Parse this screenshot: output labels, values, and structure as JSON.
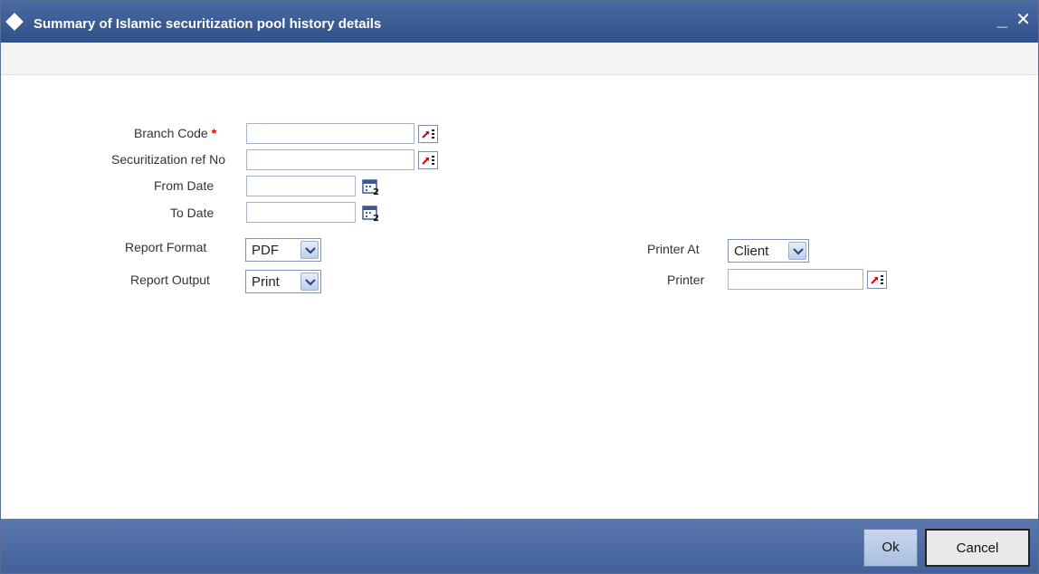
{
  "window": {
    "title": "Summary of Islamic securitization pool history details",
    "minimize_label": "_",
    "close_label": "✕"
  },
  "form": {
    "branch_code": {
      "label": "Branch Code",
      "required_mark": "*",
      "value": ""
    },
    "securitization_ref": {
      "label": "Securitization ref No",
      "value": ""
    },
    "from_date": {
      "label": "From Date",
      "value": ""
    },
    "to_date": {
      "label": "To Date",
      "value": ""
    },
    "report_format": {
      "label": "Report Format",
      "selected": "PDF"
    },
    "report_output": {
      "label": "Report Output",
      "selected": "Print"
    },
    "printer_at": {
      "label": "Printer At",
      "selected": "Client"
    },
    "printer": {
      "label": "Printer",
      "value": ""
    }
  },
  "footer": {
    "ok_label": "Ok",
    "cancel_label": "Cancel"
  },
  "colors": {
    "titlebar": "#3a5a92",
    "footer": "#4d6ba3",
    "required": "#dd0000"
  },
  "icons": {
    "lov": "list-of-values-icon",
    "calendar": "calendar-icon",
    "dropdown": "chevron-down-icon"
  }
}
